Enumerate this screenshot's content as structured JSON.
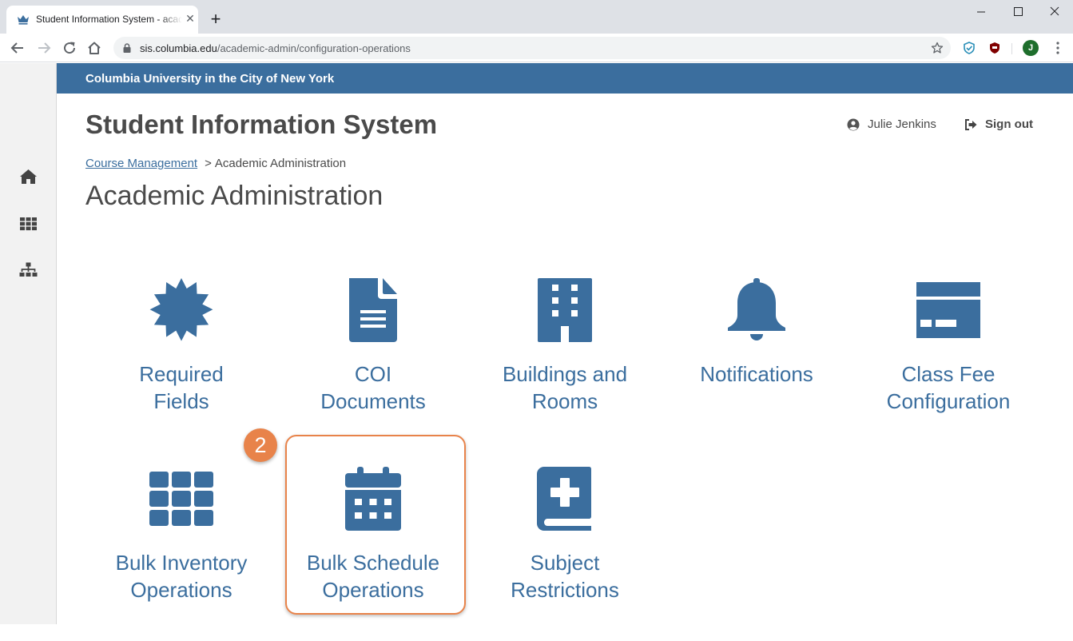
{
  "browser": {
    "tab_title": "Student Information System - academic-admin",
    "new_tab": "+",
    "url_host": "sis.columbia.edu",
    "url_path": "/academic-admin/configuration-operations",
    "profile_initial": "J"
  },
  "header": {
    "university": "Columbia University in the City of New York",
    "app_title": "Student Information System",
    "user_name": "Julie Jenkins",
    "sign_out": "Sign out"
  },
  "breadcrumb": {
    "parent": "Course Management",
    "separator": ">",
    "current": "Academic Administration"
  },
  "page": {
    "heading": "Academic Administration"
  },
  "tiles": [
    {
      "line1": "Required",
      "line2": "Fields",
      "icon": "certificate-icon"
    },
    {
      "line1": "COI",
      "line2": "Documents",
      "icon": "document-icon"
    },
    {
      "line1": "Buildings and",
      "line2": "Rooms",
      "icon": "building-icon"
    },
    {
      "line1": "Notifications",
      "line2": "",
      "icon": "bell-icon"
    },
    {
      "line1": "Class Fee",
      "line2": "Configuration",
      "icon": "credit-card-icon"
    },
    {
      "line1": "Bulk Inventory",
      "line2": "Operations",
      "icon": "grid-icon"
    },
    {
      "line1": "Bulk Schedule",
      "line2": "Operations",
      "icon": "calendar-icon"
    },
    {
      "line1": "Subject",
      "line2": "Restrictions",
      "icon": "medical-book-icon"
    }
  ],
  "annotation": {
    "step_number": "2"
  },
  "colors": {
    "brand_blue": "#3b6e9e",
    "highlight_orange": "#e8834a",
    "text_dark": "#4a4a4a"
  }
}
